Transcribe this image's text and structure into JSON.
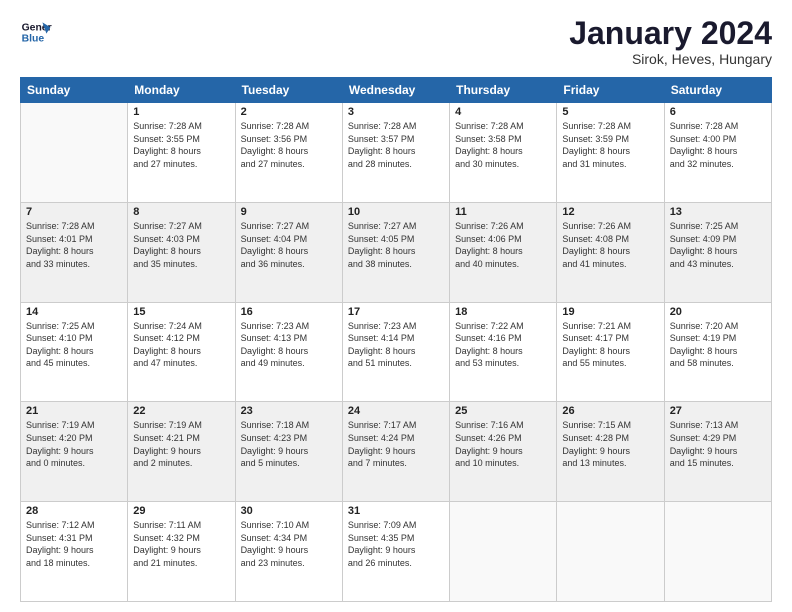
{
  "header": {
    "title": "January 2024",
    "subtitle": "Sirok, Heves, Hungary",
    "logo_line1": "General",
    "logo_line2": "Blue"
  },
  "days_of_week": [
    "Sunday",
    "Monday",
    "Tuesday",
    "Wednesday",
    "Thursday",
    "Friday",
    "Saturday"
  ],
  "weeks": [
    [
      {
        "day": "",
        "info": ""
      },
      {
        "day": "1",
        "info": "Sunrise: 7:28 AM\nSunset: 3:55 PM\nDaylight: 8 hours\nand 27 minutes."
      },
      {
        "day": "2",
        "info": "Sunrise: 7:28 AM\nSunset: 3:56 PM\nDaylight: 8 hours\nand 27 minutes."
      },
      {
        "day": "3",
        "info": "Sunrise: 7:28 AM\nSunset: 3:57 PM\nDaylight: 8 hours\nand 28 minutes."
      },
      {
        "day": "4",
        "info": "Sunrise: 7:28 AM\nSunset: 3:58 PM\nDaylight: 8 hours\nand 30 minutes."
      },
      {
        "day": "5",
        "info": "Sunrise: 7:28 AM\nSunset: 3:59 PM\nDaylight: 8 hours\nand 31 minutes."
      },
      {
        "day": "6",
        "info": "Sunrise: 7:28 AM\nSunset: 4:00 PM\nDaylight: 8 hours\nand 32 minutes."
      }
    ],
    [
      {
        "day": "7",
        "info": "Sunrise: 7:28 AM\nSunset: 4:01 PM\nDaylight: 8 hours\nand 33 minutes."
      },
      {
        "day": "8",
        "info": "Sunrise: 7:27 AM\nSunset: 4:03 PM\nDaylight: 8 hours\nand 35 minutes."
      },
      {
        "day": "9",
        "info": "Sunrise: 7:27 AM\nSunset: 4:04 PM\nDaylight: 8 hours\nand 36 minutes."
      },
      {
        "day": "10",
        "info": "Sunrise: 7:27 AM\nSunset: 4:05 PM\nDaylight: 8 hours\nand 38 minutes."
      },
      {
        "day": "11",
        "info": "Sunrise: 7:26 AM\nSunset: 4:06 PM\nDaylight: 8 hours\nand 40 minutes."
      },
      {
        "day": "12",
        "info": "Sunrise: 7:26 AM\nSunset: 4:08 PM\nDaylight: 8 hours\nand 41 minutes."
      },
      {
        "day": "13",
        "info": "Sunrise: 7:25 AM\nSunset: 4:09 PM\nDaylight: 8 hours\nand 43 minutes."
      }
    ],
    [
      {
        "day": "14",
        "info": "Sunrise: 7:25 AM\nSunset: 4:10 PM\nDaylight: 8 hours\nand 45 minutes."
      },
      {
        "day": "15",
        "info": "Sunrise: 7:24 AM\nSunset: 4:12 PM\nDaylight: 8 hours\nand 47 minutes."
      },
      {
        "day": "16",
        "info": "Sunrise: 7:23 AM\nSunset: 4:13 PM\nDaylight: 8 hours\nand 49 minutes."
      },
      {
        "day": "17",
        "info": "Sunrise: 7:23 AM\nSunset: 4:14 PM\nDaylight: 8 hours\nand 51 minutes."
      },
      {
        "day": "18",
        "info": "Sunrise: 7:22 AM\nSunset: 4:16 PM\nDaylight: 8 hours\nand 53 minutes."
      },
      {
        "day": "19",
        "info": "Sunrise: 7:21 AM\nSunset: 4:17 PM\nDaylight: 8 hours\nand 55 minutes."
      },
      {
        "day": "20",
        "info": "Sunrise: 7:20 AM\nSunset: 4:19 PM\nDaylight: 8 hours\nand 58 minutes."
      }
    ],
    [
      {
        "day": "21",
        "info": "Sunrise: 7:19 AM\nSunset: 4:20 PM\nDaylight: 9 hours\nand 0 minutes."
      },
      {
        "day": "22",
        "info": "Sunrise: 7:19 AM\nSunset: 4:21 PM\nDaylight: 9 hours\nand 2 minutes."
      },
      {
        "day": "23",
        "info": "Sunrise: 7:18 AM\nSunset: 4:23 PM\nDaylight: 9 hours\nand 5 minutes."
      },
      {
        "day": "24",
        "info": "Sunrise: 7:17 AM\nSunset: 4:24 PM\nDaylight: 9 hours\nand 7 minutes."
      },
      {
        "day": "25",
        "info": "Sunrise: 7:16 AM\nSunset: 4:26 PM\nDaylight: 9 hours\nand 10 minutes."
      },
      {
        "day": "26",
        "info": "Sunrise: 7:15 AM\nSunset: 4:28 PM\nDaylight: 9 hours\nand 13 minutes."
      },
      {
        "day": "27",
        "info": "Sunrise: 7:13 AM\nSunset: 4:29 PM\nDaylight: 9 hours\nand 15 minutes."
      }
    ],
    [
      {
        "day": "28",
        "info": "Sunrise: 7:12 AM\nSunset: 4:31 PM\nDaylight: 9 hours\nand 18 minutes."
      },
      {
        "day": "29",
        "info": "Sunrise: 7:11 AM\nSunset: 4:32 PM\nDaylight: 9 hours\nand 21 minutes."
      },
      {
        "day": "30",
        "info": "Sunrise: 7:10 AM\nSunset: 4:34 PM\nDaylight: 9 hours\nand 23 minutes."
      },
      {
        "day": "31",
        "info": "Sunrise: 7:09 AM\nSunset: 4:35 PM\nDaylight: 9 hours\nand 26 minutes."
      },
      {
        "day": "",
        "info": ""
      },
      {
        "day": "",
        "info": ""
      },
      {
        "day": "",
        "info": ""
      }
    ]
  ]
}
